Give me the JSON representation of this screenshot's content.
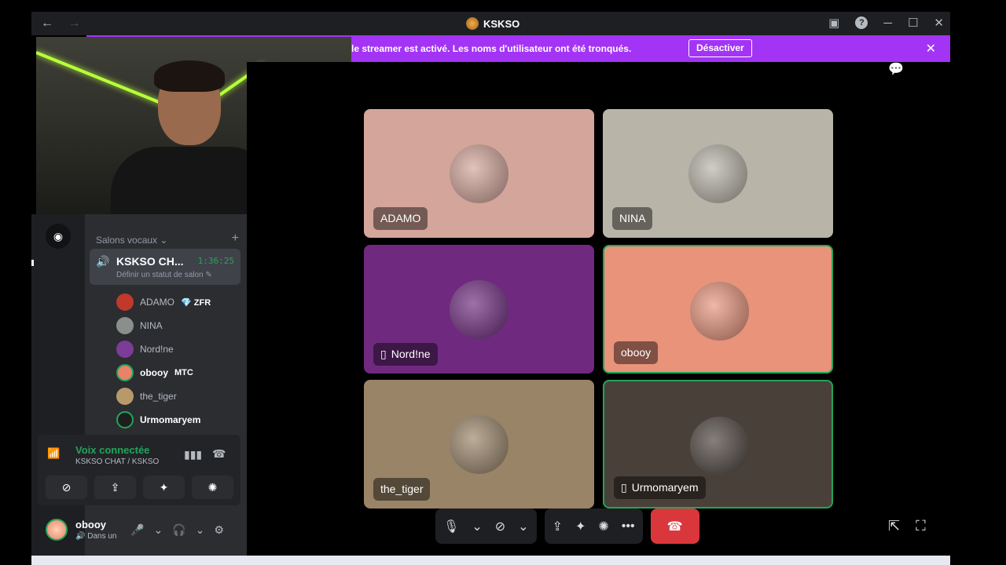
{
  "window": {
    "title": "KSKSO",
    "nav_back": "←",
    "nav_forward": "→"
  },
  "banner": {
    "text": "le streamer est activé. Les noms d'utilisateur ont été tronqués.",
    "button": "Désactiver",
    "close": "✕"
  },
  "sidebar": {
    "category": "Salons vocaux",
    "channel": {
      "name": "KSKSO CH...",
      "timer": "1:36:25",
      "status": "Définir un statut de salon"
    },
    "members": [
      {
        "name": "ADAMO",
        "badge": "💎 ZFR",
        "active": false,
        "color": "#c0392b"
      },
      {
        "name": "NINA",
        "badge": "",
        "active": false,
        "color": "#8a8f8c"
      },
      {
        "name": "Nord!ne",
        "badge": "",
        "active": false,
        "color": "#7d3c98"
      },
      {
        "name": "obooy",
        "badge": "MTC",
        "active": true,
        "color": "#e8826a"
      },
      {
        "name": "the_tiger",
        "badge": "",
        "active": false,
        "color": "#b89a6a"
      },
      {
        "name": "Urmomaryem",
        "badge": "",
        "active": true,
        "color": "#1e1e1e"
      }
    ]
  },
  "voice_panel": {
    "title": "Voix connectée",
    "subtitle": "KSKSO CHAT / KSKSO"
  },
  "user": {
    "name": "obooy",
    "status": "Dans un"
  },
  "tiles": [
    {
      "name": "ADAMO",
      "bg": "#d4a59a",
      "speaking": false,
      "mobile": false
    },
    {
      "name": "NINA",
      "bg": "#b8b4a8",
      "speaking": false,
      "mobile": false
    },
    {
      "name": "Nord!ne",
      "bg": "#6f2a80",
      "speaking": false,
      "mobile": true
    },
    {
      "name": "obooy",
      "bg": "#e8937a",
      "speaking": true,
      "mobile": false
    },
    {
      "name": "the_tiger",
      "bg": "#9a8467",
      "speaking": false,
      "mobile": false
    },
    {
      "name": "Urmomaryem",
      "bg": "#4a403a",
      "speaking": true,
      "mobile": true
    }
  ]
}
